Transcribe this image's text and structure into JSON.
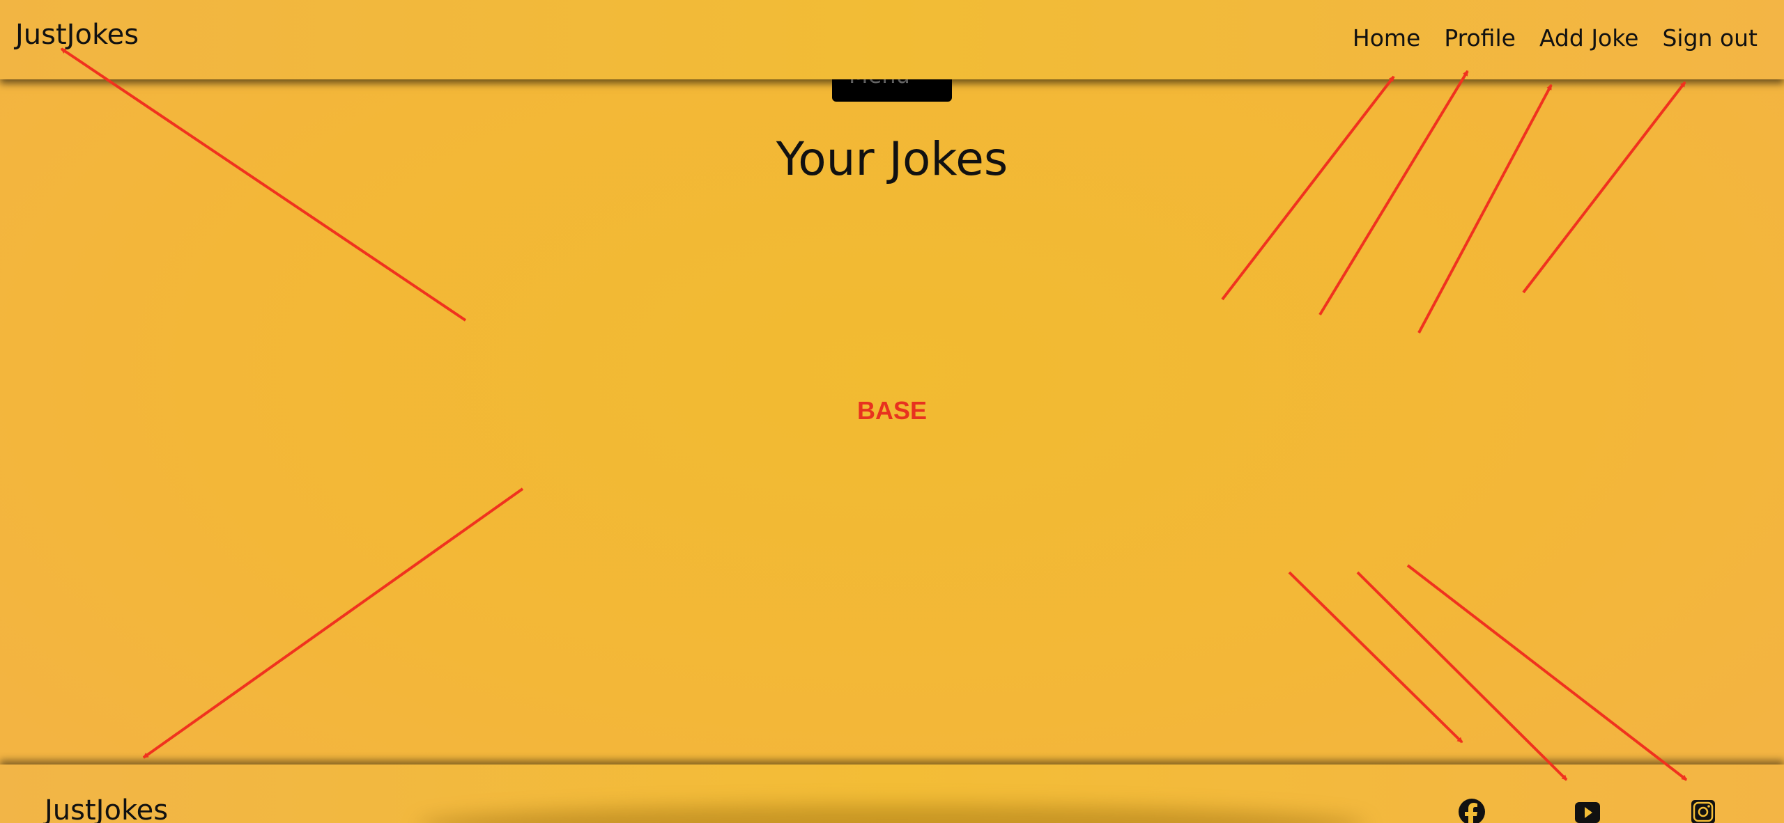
{
  "navbar": {
    "brand": "JustJokes",
    "links": [
      {
        "label": "Home"
      },
      {
        "label": "Profile"
      },
      {
        "label": "Add Joke"
      },
      {
        "label": "Sign out"
      }
    ]
  },
  "menu_button": {
    "label": "Menu"
  },
  "main": {
    "title": "Your Jokes",
    "base_annotation": "BASE"
  },
  "footer": {
    "brand": "JustJokes",
    "social": [
      "facebook-icon",
      "youtube-icon",
      "instagram-icon"
    ]
  },
  "colors": {
    "background": "#f3b83a",
    "annotation_red": "#e8321f",
    "text": "#111111"
  }
}
